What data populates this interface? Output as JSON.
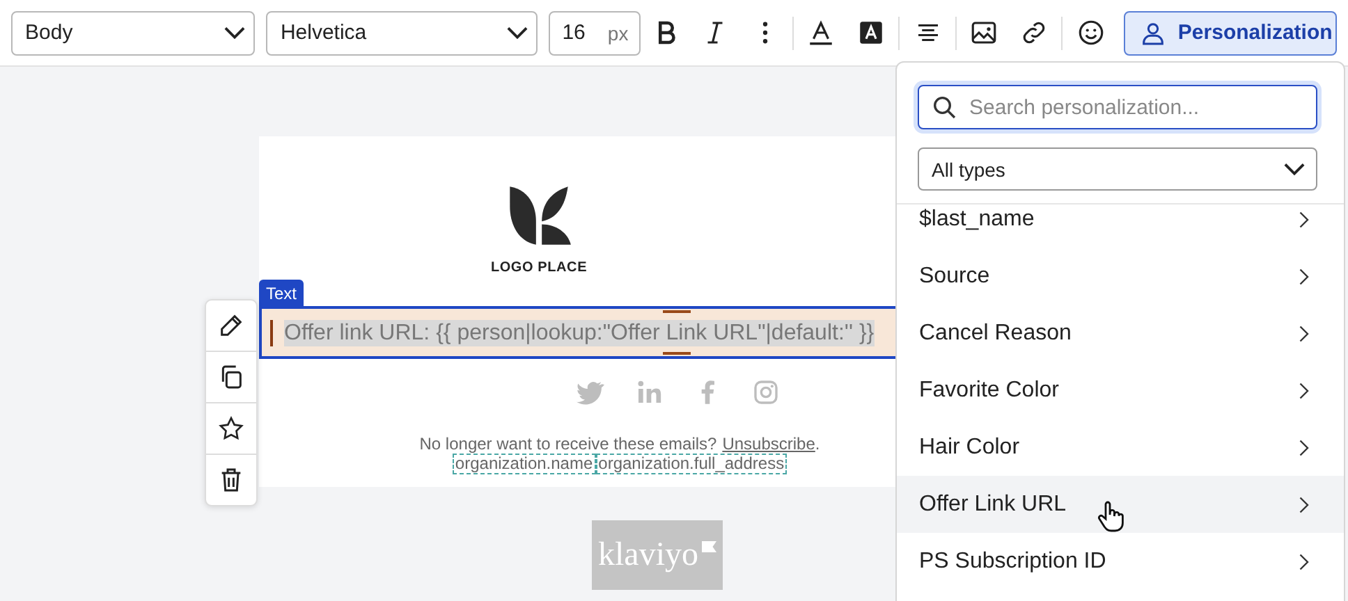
{
  "toolbar": {
    "style_select": "Body",
    "font_select": "Helvetica",
    "font_size": "16",
    "font_unit": "px",
    "personalization_button": {
      "label": "Personalization",
      "selected": true
    }
  },
  "email": {
    "logo_text": "LOGO PLACE",
    "block_label": "Text",
    "text_block": "Offer link URL: {{ person|lookup:\"Offer Link URL\"|default:'' }}",
    "footer_text": "No longer want to receive these emails?",
    "unsubscribe_link": "Unsubscribe",
    "footer_end": ".",
    "tags": [
      "organization.name",
      "organization.full_address"
    ],
    "brand": "klaviyo"
  },
  "personalization_panel": {
    "search": {
      "placeholder": "Search personalization..."
    },
    "type_select": "All types",
    "items": [
      {
        "label": "$last_name",
        "hovered": false
      },
      {
        "label": "Source",
        "hovered": false
      },
      {
        "label": "Cancel Reason",
        "hovered": false
      },
      {
        "label": "Favorite Color",
        "hovered": false
      },
      {
        "label": "Hair Color",
        "hovered": false
      },
      {
        "label": "Offer Link URL",
        "hovered": true
      },
      {
        "label": "PS Subscription ID",
        "hovered": false
      }
    ]
  }
}
